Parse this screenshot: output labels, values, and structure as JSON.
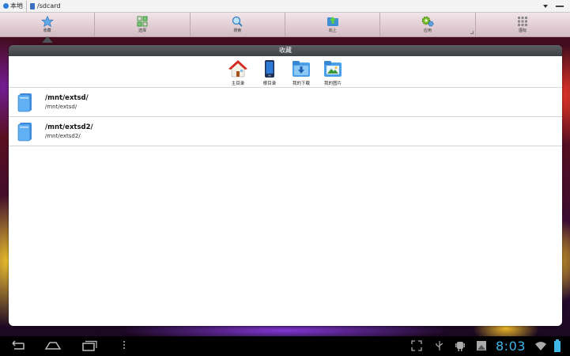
{
  "address_bar": {
    "location_label": "本地",
    "path": "/sdcard"
  },
  "toolbar": {
    "items": [
      {
        "label": "收藏",
        "icon": "star-icon"
      },
      {
        "label": "选择",
        "icon": "select-icon"
      },
      {
        "label": "搜索",
        "icon": "search-icon"
      },
      {
        "label": "向上",
        "icon": "folder-up-icon"
      },
      {
        "label": "应用",
        "icon": "apps-gear-icon"
      },
      {
        "label": "图标",
        "icon": "grid-view-icon"
      }
    ]
  },
  "favorites": {
    "title": "收藏",
    "shortcuts": [
      {
        "label": "主目录",
        "icon": "home-icon"
      },
      {
        "label": "根目录",
        "icon": "phone-root-icon"
      },
      {
        "label": "我的下载",
        "icon": "download-folder-icon"
      },
      {
        "label": "我的图片",
        "icon": "pictures-folder-icon"
      }
    ],
    "entries": [
      {
        "title": "/mnt/extsd/",
        "subtitle": "/mnt/extsd/"
      },
      {
        "title": "/mnt/extsd2/",
        "subtitle": "/mnt/extsd2/"
      }
    ]
  },
  "system_bar": {
    "time": "8:03"
  },
  "colors": {
    "accent": "#3fb6e8",
    "folder_blue": "#3b6fc2",
    "toolbar_bg": "#e2d0d6",
    "panel_header": "#4a4d50"
  }
}
